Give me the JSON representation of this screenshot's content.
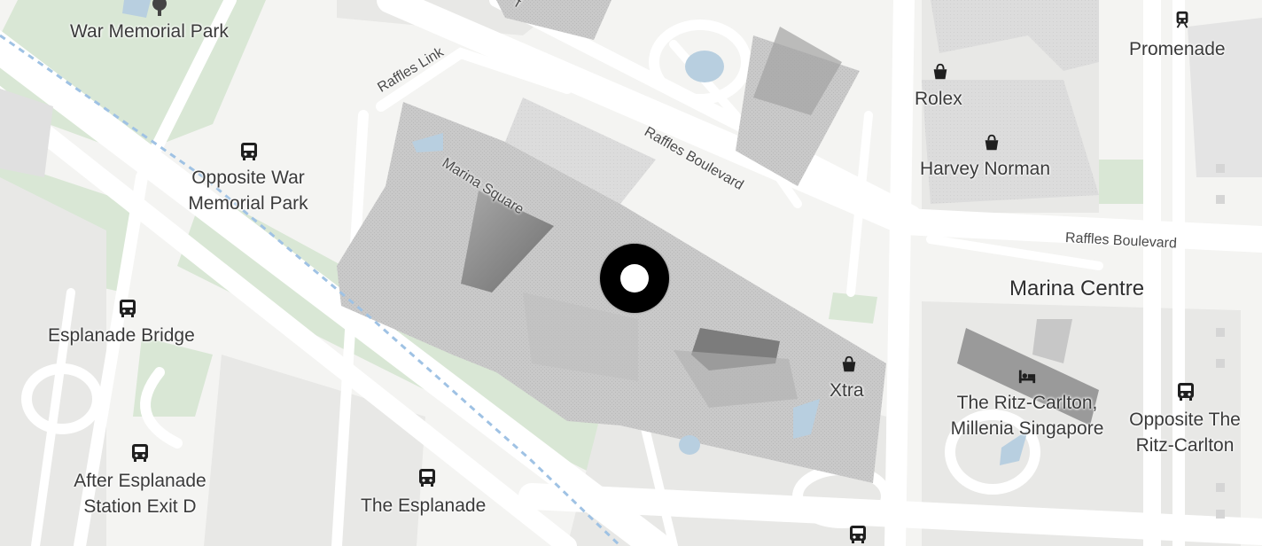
{
  "places": {
    "war_memorial_park": "War Memorial Park",
    "opposite_war_memorial_park_line1": "Opposite War",
    "opposite_war_memorial_park_line2": "Memorial Park",
    "esplanade_bridge": "Esplanade Bridge",
    "after_esplanade_line1": "After Esplanade",
    "after_esplanade_line2": "Station Exit D",
    "the_esplanade": "The Esplanade",
    "promenade": "Promenade",
    "rolex": "Rolex",
    "harvey_norman": "Harvey Norman",
    "marina_centre": "Marina Centre",
    "xtra": "Xtra",
    "ritz_line1": "The Ritz-Carlton,",
    "ritz_line2": "Millenia Singapore",
    "opp_ritz_line1": "Opposite The",
    "opp_ritz_line2": "Ritz-Carlton"
  },
  "roads": {
    "raffles_link": "Raffles Link",
    "raffles_boulevard_diag": "Raffles Boulevard",
    "raffles_boulevard_east": "Raffles Boulevard",
    "marina_square": "Marina Square",
    "top_fragment": "f"
  },
  "icons": {
    "bus": "bus-stop-icon",
    "shop": "shopping-bag-icon",
    "hotel": "hotel-bed-icon",
    "train": "train-station-icon",
    "tree": "tree-icon"
  },
  "colors": {
    "land": "#f4f4f2",
    "park": "#d7e6d3",
    "building": "#c7c7c7",
    "building_dark": "#9e9e9e",
    "road": "#ffffff",
    "water": "#b8cfe0",
    "marker": "#000000"
  }
}
